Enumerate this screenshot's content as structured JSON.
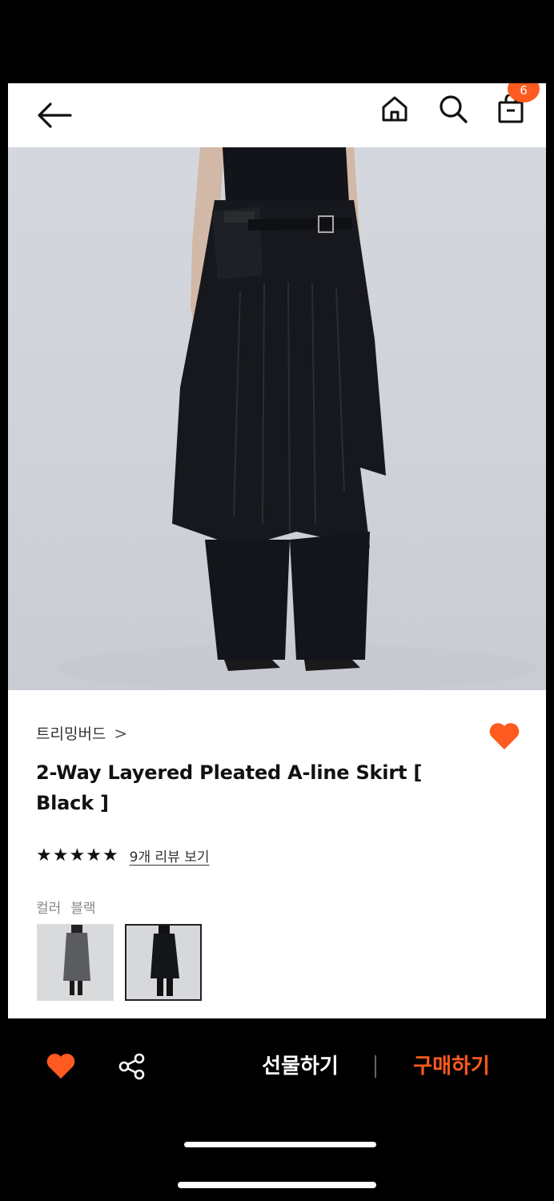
{
  "header": {
    "cart_count": "6"
  },
  "product": {
    "brand": "트리밍버드",
    "brand_chevron": ">",
    "title": "2-Way Layered Pleated A-line Skirt [ Black ]",
    "rating_stars": 5,
    "review_link": "9개 리뷰 보기",
    "color_label": "컬러",
    "color_value": "블랙",
    "swatches": [
      "gray-option",
      "black-option"
    ],
    "selected_swatch": "black-option"
  },
  "bottom_bar": {
    "gift_label": "선물하기",
    "buy_label": "구매하기"
  },
  "colors": {
    "accent": "#ff5a1f",
    "background": "#ffffff",
    "bottom_bar": "#000000"
  },
  "icons": [
    "back-arrow-icon",
    "home-icon",
    "search-icon",
    "shopping-bag-icon",
    "heart-icon",
    "share-icon"
  ]
}
